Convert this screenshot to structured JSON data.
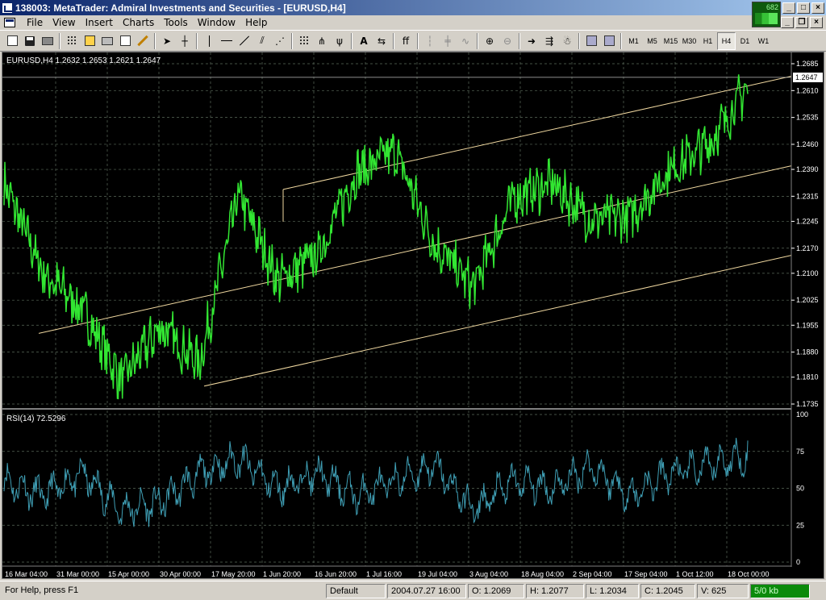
{
  "window": {
    "title": "138003: MetaTrader: Admiral Investments and Securities - [EURUSD,H4]",
    "connection_label": "682"
  },
  "menu": [
    "File",
    "View",
    "Insert",
    "Charts",
    "Tools",
    "Window",
    "Help"
  ],
  "toolbar": {
    "timeframes": [
      "M1",
      "M5",
      "M15",
      "M30",
      "H1",
      "H4",
      "D1",
      "W1"
    ],
    "active_timeframe": "H4",
    "text_tool": "A"
  },
  "chart": {
    "symbol_info": "EURUSD,H4  1.2632 1.2653 1.2621 1.2647",
    "current_price": "1.2647",
    "price_ticks": [
      "1.2685",
      "1.2610",
      "1.2535",
      "1.2460",
      "1.2390",
      "1.2315",
      "1.2245",
      "1.2170",
      "1.2100",
      "1.2025",
      "1.1955",
      "1.1880",
      "1.1810",
      "1.1735"
    ],
    "rsi_label": "RSI(14)  72.5296",
    "rsi_ticks": [
      "100",
      "75",
      "50",
      "25",
      "0"
    ],
    "date_ticks": [
      "16 Mar 04:00",
      "31 Mar 00:00",
      "15 Apr 00:00",
      "30 Apr 00:00",
      "17 May 20:00",
      "1 Jun 20:00",
      "16 Jun 20:00",
      "1 Jul 16:00",
      "19 Jul 04:00",
      "3 Aug 04:00",
      "18 Aug 04:00",
      "2 Sep 04:00",
      "17 Sep 04:00",
      "1 Oct 12:00",
      "18 Oct 00:00"
    ],
    "colors": {
      "background": "#000000",
      "price": "#32e632",
      "rsi": "#3f9fb5",
      "channel": "#f0d8a0",
      "grid": "#5a6a5a"
    }
  },
  "chart_data": {
    "type": "line",
    "title": "EURUSD,H4",
    "ylim": [
      1.1735,
      1.2685
    ],
    "x": [
      "16 Mar 04:00",
      "31 Mar 00:00",
      "15 Apr 00:00",
      "30 Apr 00:00",
      "17 May 20:00",
      "1 Jun 20:00",
      "16 Jun 20:00",
      "1 Jul 16:00",
      "19 Jul 04:00",
      "3 Aug 04:00",
      "18 Aug 04:00",
      "2 Sep 04:00",
      "17 Sep 04:00",
      "1 Oct 12:00",
      "18 Oct 00:00"
    ],
    "series": [
      {
        "values": [
          1.235,
          1.21,
          1.2,
          1.18,
          1.195,
          1.185,
          1.232,
          1.208,
          1.215,
          1.238,
          1.244,
          1.218,
          1.206,
          1.231,
          1.235,
          1.225,
          1.226,
          1.239,
          1.246,
          1.262
        ]
      }
    ],
    "rsi": {
      "ylim": [
        0,
        100
      ],
      "values": [
        55,
        45,
        60,
        35,
        40,
        60,
        70,
        50,
        60,
        45,
        55,
        65,
        35,
        55,
        50,
        65,
        45,
        60,
        65,
        72.5
      ]
    }
  },
  "status": {
    "help": "For Help, press F1",
    "profile": "Default",
    "datetime": "2004.07.27 16:00",
    "open": "O: 1.2069",
    "high": "H: 1.2077",
    "low": "L: 1.2034",
    "close": "C: 1.2045",
    "volume": "V: 625",
    "traffic": "5/0 kb"
  }
}
